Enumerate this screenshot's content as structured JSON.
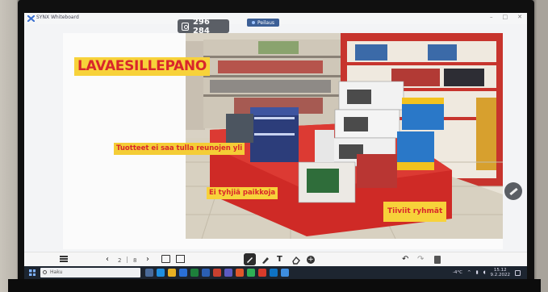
{
  "window": {
    "app_title": "SYNX Whiteboard",
    "controls": [
      "–",
      "□",
      "✕"
    ]
  },
  "badge": {
    "icon": "id-card-icon",
    "value": "296 284"
  },
  "share": {
    "label": "Peilaus"
  },
  "slide": {
    "title": "LAVAESILLEPANO",
    "notes": [
      "Tuotteet ei saa tulla reunojen yli",
      "Ei tyhjiä paikkoja",
      "Tiiviit ryhmät"
    ],
    "photo_subject": "store-display-photo"
  },
  "toolbar": {
    "page_prev": "‹",
    "page_current": "2",
    "page_sep": "|",
    "page_total": "8",
    "page_next": "›",
    "icons": [
      "menu-icon",
      "export-icon",
      "pages-icon",
      "pen-icon",
      "marker-icon",
      "text-icon",
      "eraser-icon",
      "add-icon",
      "undo-icon",
      "redo-icon",
      "trash-icon"
    ],
    "text_tool": "T",
    "add_tool": "+",
    "undo": "↶",
    "redo": "↷"
  },
  "taskbar": {
    "search_placeholder": "Haku",
    "weather": "-4°C",
    "time": "15.12",
    "date": "9.2.2022"
  },
  "colors": {
    "label_text": "#d9262b",
    "label_bg": "#f7d23a",
    "display_red": "#d12a28",
    "taskbar": "#1d2530"
  }
}
